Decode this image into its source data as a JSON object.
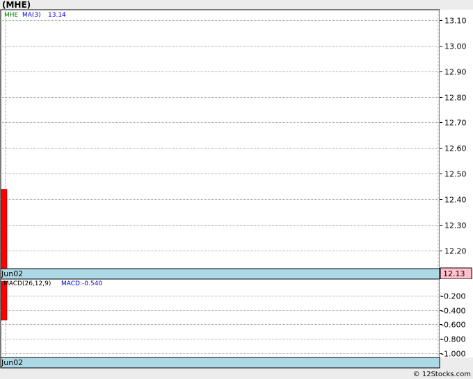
{
  "header": {
    "symbol": "(MHE)"
  },
  "footer": {
    "credit": "© 12Stocks.com"
  },
  "price_panel": {
    "legend": {
      "symbol": "MHE",
      "ma_label": "MA(3)",
      "ma_value": "13.14"
    },
    "last_price_label": "12.13",
    "date_label": "Jun02"
  },
  "macd_panel": {
    "legend": {
      "label": "MACD(26,12,9)",
      "value_label": "MACD:-0.540"
    },
    "date_label": "Jun02"
  },
  "colors": {
    "candle": "#ff0000",
    "band": "#add8e6",
    "last_price_box": "#ffc0cb",
    "legend_green": "#008000",
    "legend_blue": "#0000cd",
    "grid": "#a0a0a0"
  },
  "chart_data": [
    {
      "type": "bar",
      "panel": "price",
      "categories": [
        "Jun02"
      ],
      "series": [
        {
          "values": [
            {
              "low": 12.13,
              "high": 12.44
            }
          ]
        }
      ],
      "ylim": [
        12.13,
        13.14
      ],
      "yticks": [
        12.2,
        12.3,
        12.4,
        12.5,
        12.6,
        12.7,
        12.8,
        12.9,
        13.0,
        13.1
      ],
      "ytick_labels": [
        "12.20",
        "12.30",
        "12.40",
        "12.50",
        "12.60",
        "12.70",
        "12.80",
        "12.90",
        "13.00",
        "13.10"
      ],
      "grid": true
    },
    {
      "type": "bar",
      "panel": "macd",
      "categories": [
        "Jun02"
      ],
      "series": [
        {
          "values": [
            {
              "low": -0.54,
              "high": 0.0
            }
          ]
        }
      ],
      "ylim": [
        -1.06,
        0.03
      ],
      "yticks": [
        -0.2,
        -0.4,
        -0.6,
        -0.8,
        -1.0
      ],
      "ytick_labels": [
        "-0.200",
        "-0.400",
        "-0.600",
        "-0.800",
        "-1.000"
      ],
      "grid": true
    }
  ]
}
